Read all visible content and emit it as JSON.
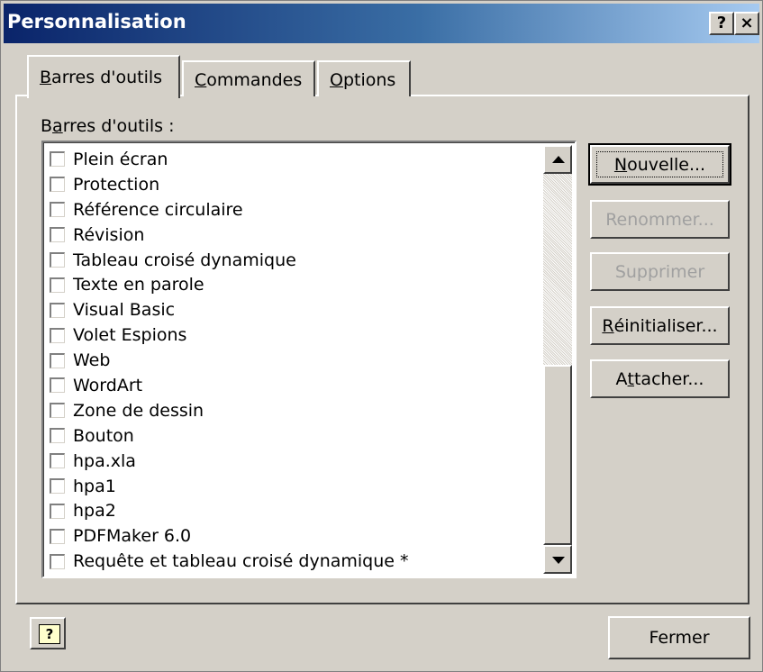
{
  "window": {
    "title": "Personnalisation",
    "help_glyph": "?",
    "close_glyph": "×"
  },
  "tabs": [
    {
      "label_mn": "B",
      "label_rest": "arres d'outils",
      "active": true
    },
    {
      "label_mn": "C",
      "label_rest": "ommandes",
      "active": false
    },
    {
      "label_mn": "O",
      "label_rest": "ptions",
      "active": false
    }
  ],
  "list_label": {
    "pre": "B",
    "mn": "a",
    "post": "rres d'outils :"
  },
  "toolbars": [
    {
      "label": "Plein écran",
      "checked": false
    },
    {
      "label": "Protection",
      "checked": false
    },
    {
      "label": "Référence circulaire",
      "checked": false
    },
    {
      "label": "Révision",
      "checked": false
    },
    {
      "label": "Tableau croisé dynamique",
      "checked": false
    },
    {
      "label": "Texte en parole",
      "checked": false
    },
    {
      "label": "Visual Basic",
      "checked": false
    },
    {
      "label": "Volet Espions",
      "checked": false
    },
    {
      "label": "Web",
      "checked": false
    },
    {
      "label": "WordArt",
      "checked": false
    },
    {
      "label": "Zone de dessin",
      "checked": false
    },
    {
      "label": "Bouton",
      "checked": false
    },
    {
      "label": "hpa.xla",
      "checked": false
    },
    {
      "label": "hpa1",
      "checked": false
    },
    {
      "label": "hpa2",
      "checked": false
    },
    {
      "label": "PDFMaker 6.0",
      "checked": false
    },
    {
      "label": "Requête et tableau croisé dynamique *",
      "checked": false
    }
  ],
  "buttons": {
    "nouvelle": {
      "mn": "N",
      "rest": "ouvelle...",
      "enabled": true
    },
    "renommer": {
      "label": "Renommer...",
      "enabled": false
    },
    "supprimer": {
      "label": "Supprimer",
      "enabled": false
    },
    "reinitialiser": {
      "mn": "R",
      "rest": "éinitialiser...",
      "enabled": true
    },
    "attacher": {
      "pre": "A",
      "mn": "t",
      "post": "tacher...",
      "enabled": true
    }
  },
  "footer": {
    "help_icon_glyph": "?",
    "close_label": "Fermer"
  },
  "icons": {
    "help": "help-question-icon",
    "close": "close-x-icon",
    "scroll_up": "arrow-up-icon",
    "scroll_down": "arrow-down-icon"
  },
  "colors": {
    "titlebar_start": "#0a246a",
    "titlebar_end": "#a6caf0",
    "face": "#d4d0c8",
    "disabled_text": "#a0a0a0"
  }
}
